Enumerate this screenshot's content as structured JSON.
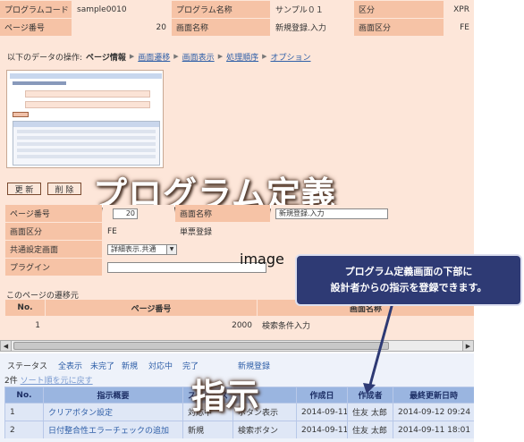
{
  "header": {
    "program_code_label": "プログラムコード",
    "program_code_value": "sample0010",
    "program_name_label": "プログラム名称",
    "program_name_value": "サンプル０１",
    "kubun_label": "区分",
    "kubun_value": "XPR",
    "page_no_label": "ページ番号",
    "page_no_value": "20",
    "screen_name_label": "画面名称",
    "screen_name_value": "新規登録.入力",
    "screen_kubun_label": "画面区分",
    "screen_kubun_value": "FE"
  },
  "ops": {
    "prefix": "以下のデータの操作:",
    "items": [
      "ページ情報",
      "画面遷移",
      "画面表示",
      "処理順序",
      "オプション"
    ]
  },
  "buttons": {
    "update": "更 新",
    "delete": "削 除"
  },
  "overlay": {
    "title": "プログラム定義",
    "instruction": "指示",
    "image_label": "image",
    "callout": "プログラム定義画面の下部に\n設計者からの指示を登録できます。"
  },
  "form": {
    "page_no_label": "ページ番号",
    "page_no_value": "20",
    "screen_name_label": "画面名称",
    "screen_name_value": "新規登録.入力",
    "screen_kubun_label": "画面区分",
    "screen_kubun_value": "FE",
    "screen_kubun_desc": "単票登録",
    "common_screen_label": "共通設定画面",
    "common_screen_value": "詳細表示.共通",
    "plugin_label": "プラグイン"
  },
  "transition": {
    "section_title": "このページの遷移元",
    "columns": [
      "No.",
      "ページ番号",
      "画面名称"
    ],
    "rows": [
      {
        "no": "1",
        "page": "2000",
        "name": "検索条件入力"
      }
    ]
  },
  "instructions": {
    "filters": [
      "ステータス",
      "全表示",
      "未完了",
      "新規",
      "対応中",
      "完了",
      "新規登録"
    ],
    "count_text": "2件",
    "sort_reset": "ソート順を元に戻す",
    "columns": [
      "No.",
      "指示概要",
      "ステータス",
      "",
      "作成日",
      "作成者",
      "最終更新日時"
    ],
    "rows": [
      {
        "no": "1",
        "summary": "クリアボタン設定",
        "status": "対応中",
        "target": "ボタン表示",
        "created": "2014-09-11",
        "author": "住友 太郎",
        "updated": "2014-09-12 09:24"
      },
      {
        "no": "2",
        "summary": "日付整合性エラーチェックの追加",
        "status": "新規",
        "target": "検索ボタン",
        "created": "2014-09-11",
        "author": "住友 太郎",
        "updated": "2014-09-11 18:01"
      }
    ]
  },
  "colors": {
    "accent_salmon": "#f6c3a6",
    "accent_peach": "#fde6d9",
    "callout_bg": "#2e3a74",
    "link": "#2f5fa8"
  }
}
